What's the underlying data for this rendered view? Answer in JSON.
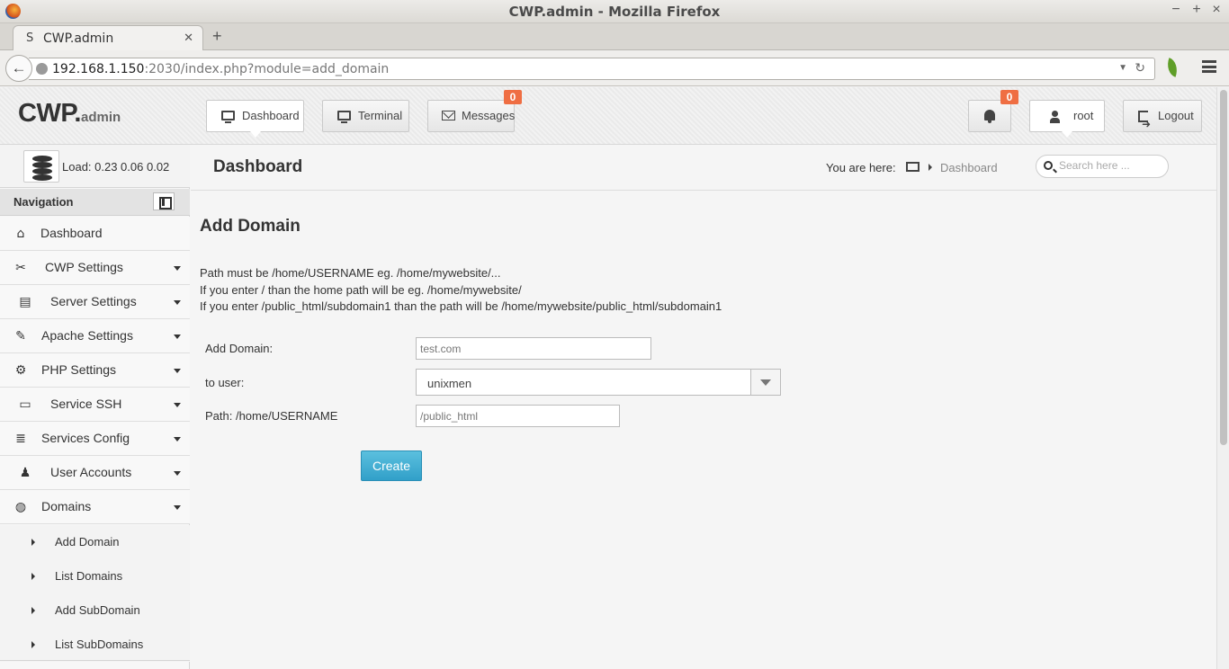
{
  "browser": {
    "window_title": "CWP.admin - Mozilla Firefox",
    "tab_favicon": "S",
    "tab_title": "CWP.admin",
    "new_tab": "+",
    "url_host": "192.168.1.150",
    "url_rest": ":2030/index.php?module=add_domain"
  },
  "header": {
    "logo_main": "CWP.",
    "logo_sub": "admin",
    "buttons": {
      "dashboard": "Dashboard",
      "terminal": "Terminal",
      "messages": "Messages",
      "messages_badge": "0",
      "notifications_badge": "0",
      "user": "root",
      "logout": "Logout"
    }
  },
  "sidebar": {
    "load_label": "Load: 0.23  0.06  0.02",
    "nav_title": "Navigation",
    "items": [
      {
        "label": "Dashboard",
        "icon": "home-icon"
      },
      {
        "label": "CWP Settings",
        "icon": "tools-icon"
      },
      {
        "label": "Server Settings",
        "icon": "server-icon"
      },
      {
        "label": "Apache Settings",
        "icon": "feather-icon"
      },
      {
        "label": "PHP Settings",
        "icon": "gear-icon"
      },
      {
        "label": "Service SSH",
        "icon": "monitor-icon"
      },
      {
        "label": "Services Config",
        "icon": "stack-icon"
      },
      {
        "label": "User Accounts",
        "icon": "user-icon"
      },
      {
        "label": "Domains",
        "icon": "globe-icon"
      }
    ],
    "sub_items": [
      "Add Domain",
      "List Domains",
      "Add SubDomain",
      "List SubDomains"
    ]
  },
  "breadcrumb": {
    "page_title": "Dashboard",
    "you_are_here": "You are here:",
    "current": "Dashboard",
    "search_placeholder": "Search here ..."
  },
  "form": {
    "title": "Add Domain",
    "notes": [
      "Path must be /home/USERNAME eg. /home/mywebsite/...",
      "If you enter / than the home path will be eg. /home/mywebsite/",
      "If you enter /public_html/subdomain1 than the path will be /home/mywebsite/public_html/subdomain1"
    ],
    "domain_label": "Add Domain:",
    "domain_placeholder": "test.com",
    "user_label": "to user:",
    "user_value": "unixmen",
    "path_label": "Path: /home/USERNAME",
    "path_placeholder": "/public_html",
    "create_button": "Create"
  }
}
